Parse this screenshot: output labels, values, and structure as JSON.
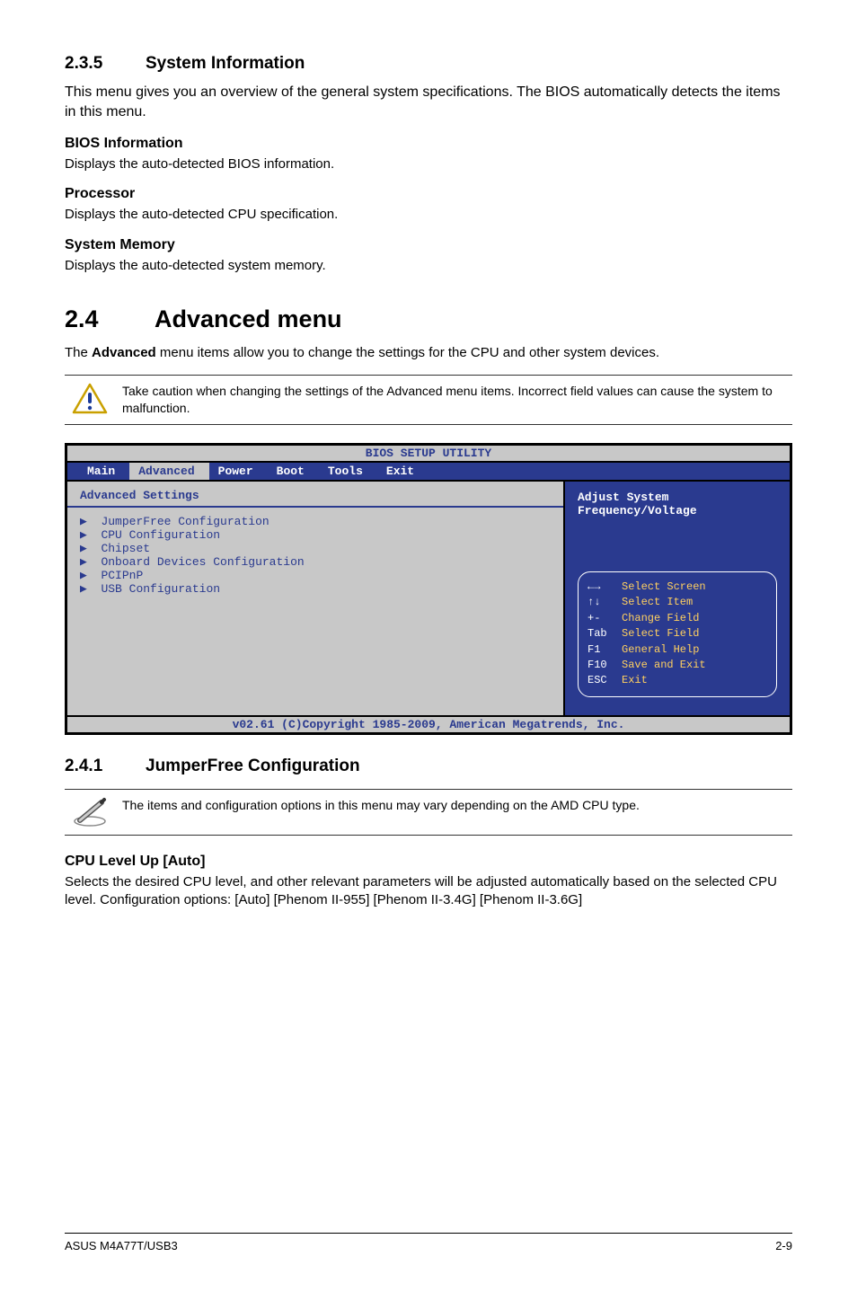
{
  "s235": {
    "num": "2.3.5",
    "title": "System Information",
    "intro": "This menu gives you an overview of the general system specifications. The BIOS automatically detects the items in this menu.",
    "bios": {
      "h": "BIOS Information",
      "p": "Displays the auto-detected BIOS information."
    },
    "proc": {
      "h": "Processor",
      "p": "Displays the auto-detected CPU specification."
    },
    "mem": {
      "h": "System Memory",
      "p": "Displays the auto-detected system memory."
    }
  },
  "s24": {
    "num": "2.4",
    "title": "Advanced menu",
    "intro_prefix": "The ",
    "intro_bold": "Advanced",
    "intro_suffix": " menu items allow you to change the settings for the CPU and other system devices.",
    "caution": "Take caution when changing the settings of the Advanced menu items. Incorrect field values can cause the system to malfunction."
  },
  "bios": {
    "title": "BIOS SETUP UTILITY",
    "tabs": [
      "Main",
      "Advanced",
      "Power",
      "Boot",
      "Tools",
      "Exit"
    ],
    "selected_tab": "Advanced",
    "heading": "Advanced Settings",
    "items": [
      "JumperFree Configuration",
      "CPU Configuration",
      "Chipset",
      "Onboard Devices Configuration",
      "PCIPnP",
      "USB Configuration"
    ],
    "help_line1": "Adjust System",
    "help_line2": "Frequency/Voltage",
    "keys": [
      {
        "k": "←→",
        "d": "Select Screen"
      },
      {
        "k": "↑↓",
        "d": "Select Item"
      },
      {
        "k": "+-",
        "d": "Change Field"
      },
      {
        "k": "Tab",
        "d": "Select Field"
      },
      {
        "k": "F1",
        "d": "General Help"
      },
      {
        "k": "F10",
        "d": "Save and Exit"
      },
      {
        "k": "ESC",
        "d": "Exit"
      }
    ],
    "footer": "v02.61 (C)Copyright 1985-2009, American Megatrends, Inc."
  },
  "s241": {
    "num": "2.4.1",
    "title": "JumperFree Configuration",
    "note": "The items and configuration options in this menu may vary depending on the AMD CPU type.",
    "cpu_h": "CPU Level Up [Auto]",
    "cpu_p": "Selects the desired CPU level, and other relevant parameters will be adjusted automatically based on the selected CPU level. Configuration options: [Auto] [Phenom II-955] [Phenom II-3.4G] [Phenom II-3.6G]"
  },
  "footer": {
    "left": "ASUS M4A77T/USB3",
    "right": "2-9"
  }
}
